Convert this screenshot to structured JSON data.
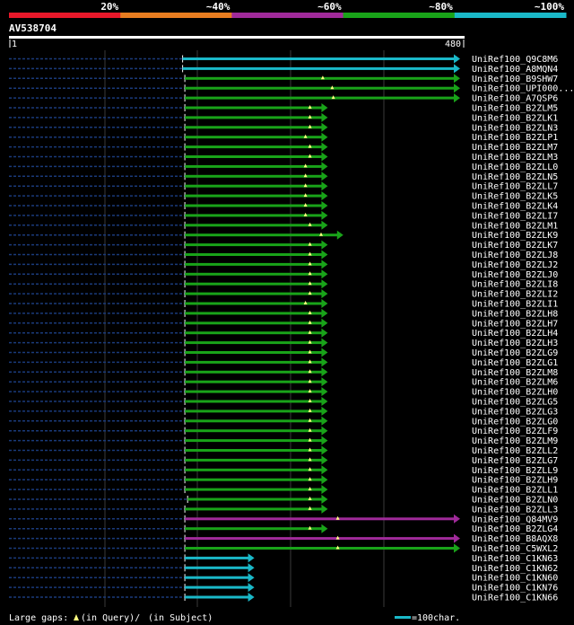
{
  "colors": {
    "background": "#000000",
    "identity_bar": [
      "#e8182a",
      "#e87d20",
      "#a02a9a",
      "#19a319",
      "#1ab8c8"
    ],
    "hit": {
      "cyan": "#1ab8c8",
      "green": "#19a319",
      "purple": "#a02a9a"
    },
    "gap_marker": "#ffff80",
    "text": "#ffffff",
    "dashed": "#1a3a7a",
    "grid": "#444444"
  },
  "identity_scale": {
    "labels": [
      "20%",
      "~40%",
      "~60%",
      "~80%",
      "~100%"
    ]
  },
  "query": {
    "name": "AV538704",
    "start_label": "1",
    "end_label": "480",
    "length": 480
  },
  "hits": [
    {
      "id": "UniRef100_Q9C8M6",
      "start": 1,
      "end": 500,
      "color": "cyan",
      "gaps": []
    },
    {
      "id": "UniRef100_A8MQN4",
      "start": 1,
      "end": 500,
      "color": "cyan",
      "gaps": []
    },
    {
      "id": "UniRef100_B9SHW7",
      "start": 5,
      "end": 500,
      "color": "green",
      "gaps": [
        253
      ]
    },
    {
      "id": "UniRef100_UPI000...",
      "start": 5,
      "end": 500,
      "color": "green",
      "gaps": [
        270
      ]
    },
    {
      "id": "UniRef100_A7QSP6",
      "start": 5,
      "end": 500,
      "color": "green",
      "gaps": [
        272
      ]
    },
    {
      "id": "UniRef100_B2ZLM5",
      "start": 5,
      "end": 262,
      "color": "green",
      "gaps": [
        230
      ]
    },
    {
      "id": "UniRef100_B2ZLK1",
      "start": 5,
      "end": 262,
      "color": "green",
      "gaps": [
        230
      ]
    },
    {
      "id": "UniRef100_B2ZLN3",
      "start": 5,
      "end": 262,
      "color": "green",
      "gaps": [
        230
      ]
    },
    {
      "id": "UniRef100_B2ZLP1",
      "start": 5,
      "end": 262,
      "color": "green",
      "gaps": [
        222
      ]
    },
    {
      "id": "UniRef100_B2ZLM7",
      "start": 5,
      "end": 262,
      "color": "green",
      "gaps": [
        230
      ]
    },
    {
      "id": "UniRef100_B2ZLM3",
      "start": 5,
      "end": 262,
      "color": "green",
      "gaps": [
        230
      ]
    },
    {
      "id": "UniRef100_B2ZLL0",
      "start": 5,
      "end": 262,
      "color": "green",
      "gaps": [
        222
      ]
    },
    {
      "id": "UniRef100_B2ZLN5",
      "start": 5,
      "end": 262,
      "color": "green",
      "gaps": [
        222
      ]
    },
    {
      "id": "UniRef100_B2ZLL7",
      "start": 5,
      "end": 262,
      "color": "green",
      "gaps": [
        222
      ]
    },
    {
      "id": "UniRef100_B2ZLK5",
      "start": 5,
      "end": 262,
      "color": "green",
      "gaps": [
        222
      ]
    },
    {
      "id": "UniRef100_B2ZLK4",
      "start": 5,
      "end": 262,
      "color": "green",
      "gaps": [
        222
      ]
    },
    {
      "id": "UniRef100_B2ZLI7",
      "start": 5,
      "end": 262,
      "color": "green",
      "gaps": [
        222
      ]
    },
    {
      "id": "UniRef100_B2ZLM1",
      "start": 5,
      "end": 262,
      "color": "green",
      "gaps": [
        230
      ]
    },
    {
      "id": "UniRef100_B2ZLK9",
      "start": 5,
      "end": 290,
      "color": "green",
      "gaps": [
        250
      ]
    },
    {
      "id": "UniRef100_B2ZLK7",
      "start": 5,
      "end": 262,
      "color": "green",
      "gaps": [
        230
      ]
    },
    {
      "id": "UniRef100_B2ZLJ8",
      "start": 5,
      "end": 262,
      "color": "green",
      "gaps": [
        230
      ]
    },
    {
      "id": "UniRef100_B2ZLJ2",
      "start": 5,
      "end": 262,
      "color": "green",
      "gaps": [
        230
      ]
    },
    {
      "id": "UniRef100_B2ZLJ0",
      "start": 5,
      "end": 262,
      "color": "green",
      "gaps": [
        230
      ]
    },
    {
      "id": "UniRef100_B2ZLI8",
      "start": 5,
      "end": 262,
      "color": "green",
      "gaps": [
        230
      ]
    },
    {
      "id": "UniRef100_B2ZLI2",
      "start": 5,
      "end": 262,
      "color": "green",
      "gaps": [
        230
      ]
    },
    {
      "id": "UniRef100_B2ZLI1",
      "start": 5,
      "end": 262,
      "color": "green",
      "gaps": [
        222
      ]
    },
    {
      "id": "UniRef100_B2ZLH8",
      "start": 5,
      "end": 262,
      "color": "green",
      "gaps": [
        230
      ]
    },
    {
      "id": "UniRef100_B2ZLH7",
      "start": 5,
      "end": 262,
      "color": "green",
      "gaps": [
        230
      ]
    },
    {
      "id": "UniRef100_B2ZLH4",
      "start": 5,
      "end": 262,
      "color": "green",
      "gaps": [
        230
      ]
    },
    {
      "id": "UniRef100_B2ZLH3",
      "start": 5,
      "end": 262,
      "color": "green",
      "gaps": [
        230
      ]
    },
    {
      "id": "UniRef100_B2ZLG9",
      "start": 5,
      "end": 262,
      "color": "green",
      "gaps": [
        230
      ]
    },
    {
      "id": "UniRef100_B2ZLG1",
      "start": 5,
      "end": 262,
      "color": "green",
      "gaps": [
        230
      ]
    },
    {
      "id": "UniRef100_B2ZLM8",
      "start": 5,
      "end": 262,
      "color": "green",
      "gaps": [
        230
      ]
    },
    {
      "id": "UniRef100_B2ZLM6",
      "start": 5,
      "end": 262,
      "color": "green",
      "gaps": [
        230
      ]
    },
    {
      "id": "UniRef100_B2ZLH0",
      "start": 5,
      "end": 262,
      "color": "green",
      "gaps": [
        230
      ]
    },
    {
      "id": "UniRef100_B2ZLG5",
      "start": 5,
      "end": 262,
      "color": "green",
      "gaps": [
        230
      ]
    },
    {
      "id": "UniRef100_B2ZLG3",
      "start": 5,
      "end": 262,
      "color": "green",
      "gaps": [
        230
      ]
    },
    {
      "id": "UniRef100_B2ZLG0",
      "start": 5,
      "end": 262,
      "color": "green",
      "gaps": [
        230
      ]
    },
    {
      "id": "UniRef100_B2ZLF9",
      "start": 5,
      "end": 262,
      "color": "green",
      "gaps": [
        230
      ]
    },
    {
      "id": "UniRef100_B2ZLM9",
      "start": 5,
      "end": 262,
      "color": "green",
      "gaps": [
        230
      ]
    },
    {
      "id": "UniRef100_B2ZLL2",
      "start": 5,
      "end": 262,
      "color": "green",
      "gaps": [
        230
      ]
    },
    {
      "id": "UniRef100_B2ZLG7",
      "start": 5,
      "end": 262,
      "color": "green",
      "gaps": [
        230
      ]
    },
    {
      "id": "UniRef100_B2ZLL9",
      "start": 5,
      "end": 262,
      "color": "green",
      "gaps": [
        230
      ]
    },
    {
      "id": "UniRef100_B2ZLH9",
      "start": 5,
      "end": 262,
      "color": "green",
      "gaps": [
        230
      ]
    },
    {
      "id": "UniRef100_B2ZLL1",
      "start": 5,
      "end": 262,
      "color": "green",
      "gaps": [
        230
      ]
    },
    {
      "id": "UniRef100_B2ZLN0",
      "start": 10,
      "end": 262,
      "color": "green",
      "gaps": [
        230
      ]
    },
    {
      "id": "UniRef100_B2ZLL3",
      "start": 5,
      "end": 262,
      "color": "green",
      "gaps": [
        230
      ]
    },
    {
      "id": "UniRef100_Q84MV9",
      "start": 5,
      "end": 500,
      "color": "purple",
      "gaps": [
        280
      ]
    },
    {
      "id": "UniRef100_B2ZLG4",
      "start": 5,
      "end": 262,
      "color": "green",
      "gaps": [
        230
      ]
    },
    {
      "id": "UniRef100_B8AQX8",
      "start": 5,
      "end": 500,
      "color": "purple",
      "gaps": [
        280
      ]
    },
    {
      "id": "UniRef100_C5WXL2",
      "start": 5,
      "end": 500,
      "color": "green",
      "gaps": [
        280
      ]
    },
    {
      "id": "UniRef100_C1KN63",
      "start": 5,
      "end": 130,
      "color": "cyan",
      "gaps": []
    },
    {
      "id": "UniRef100_C1KN62",
      "start": 5,
      "end": 130,
      "color": "cyan",
      "gaps": []
    },
    {
      "id": "UniRef100_C1KN60",
      "start": 5,
      "end": 130,
      "color": "cyan",
      "gaps": []
    },
    {
      "id": "UniRef100_C1KN76",
      "start": 5,
      "end": 130,
      "color": "cyan",
      "gaps": []
    },
    {
      "id": "UniRef100_C1KN66",
      "start": 5,
      "end": 130,
      "color": "cyan",
      "gaps": []
    }
  ],
  "legend": {
    "large_gaps_label": "Large gaps:",
    "in_query_label": "(in Query)/",
    "in_subject_label": "(in Subject)",
    "scale_label": "=100char."
  }
}
